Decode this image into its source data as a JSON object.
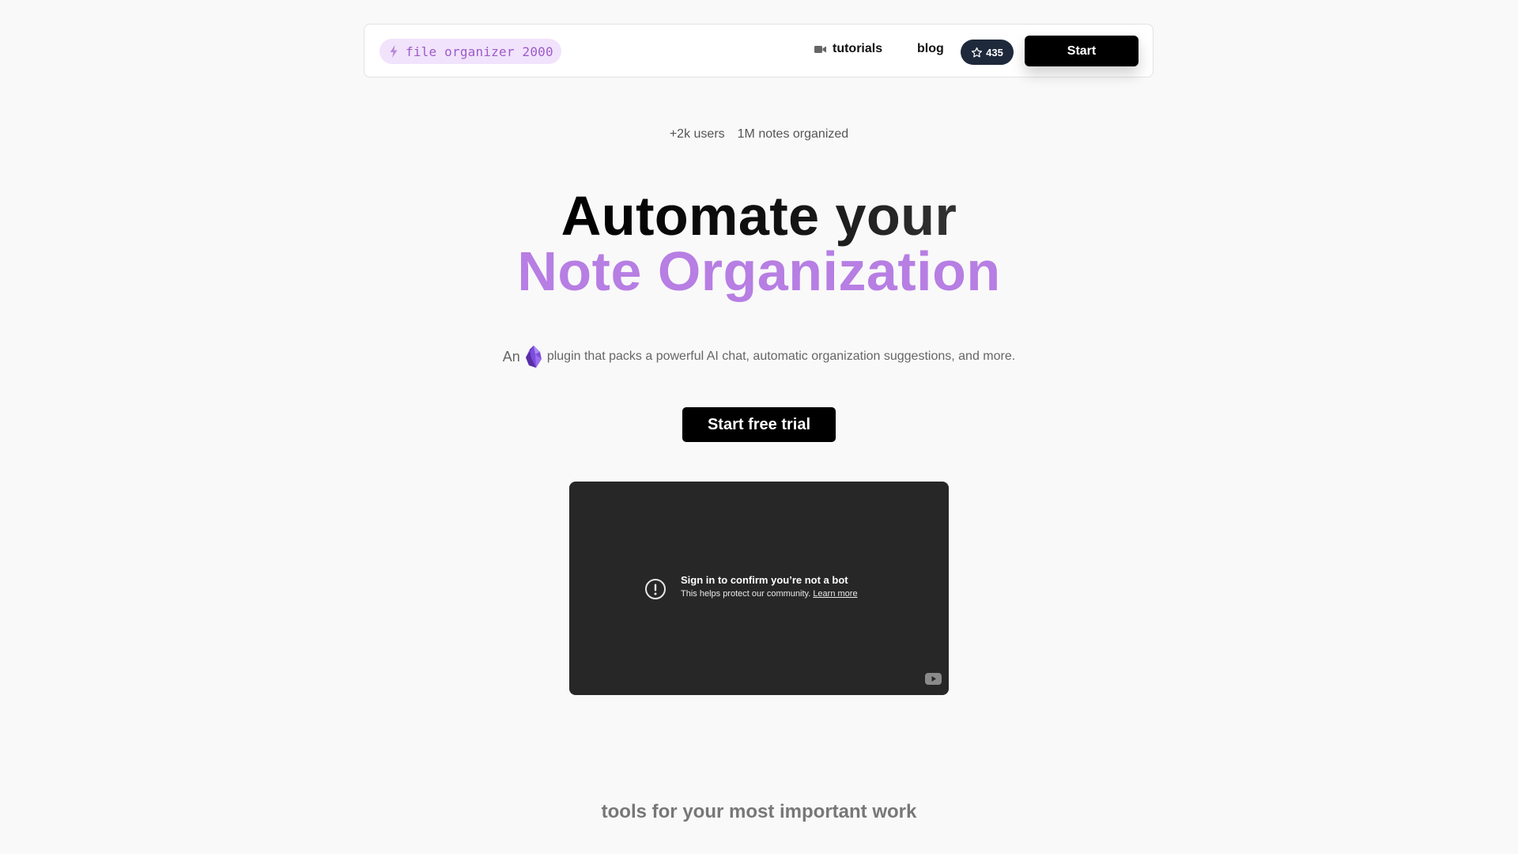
{
  "nav": {
    "brand_label": "file organizer 2000",
    "brand_icon": "bolt-icon",
    "tutorials_label": "tutorials",
    "tutorials_icon": "video-camera-icon",
    "blog_label": "blog",
    "stars_count": "435",
    "stars_icon": "star-icon",
    "start_label": "Start"
  },
  "hero": {
    "stats": [
      "+2k users",
      "1M notes organized"
    ],
    "headline_line1": "Automate your",
    "headline_line2": "Note Organization",
    "subtitle_prefix": "An",
    "subtitle_icon": "obsidian-logo-icon",
    "subtitle_text": "plugin that packs a powerful AI chat, automatic organization suggestions, and more.",
    "cta_label": "Start free trial"
  },
  "video": {
    "title": "Sign in to confirm you’re not a bot",
    "subtitle": "This helps protect our community.",
    "learn_more": "Learn more",
    "warn_icon": "exclamation-circle-icon",
    "logo_icon": "youtube-icon"
  },
  "section": {
    "title": "tools for your most important work"
  },
  "colors": {
    "background": "#f9f9f9",
    "brand_pill_bg": "#f1e3fb",
    "brand_text": "#9d5bc9",
    "headline_accent": "#b77ee3",
    "badge_bg": "#1e293b",
    "video_bg": "#272727"
  }
}
